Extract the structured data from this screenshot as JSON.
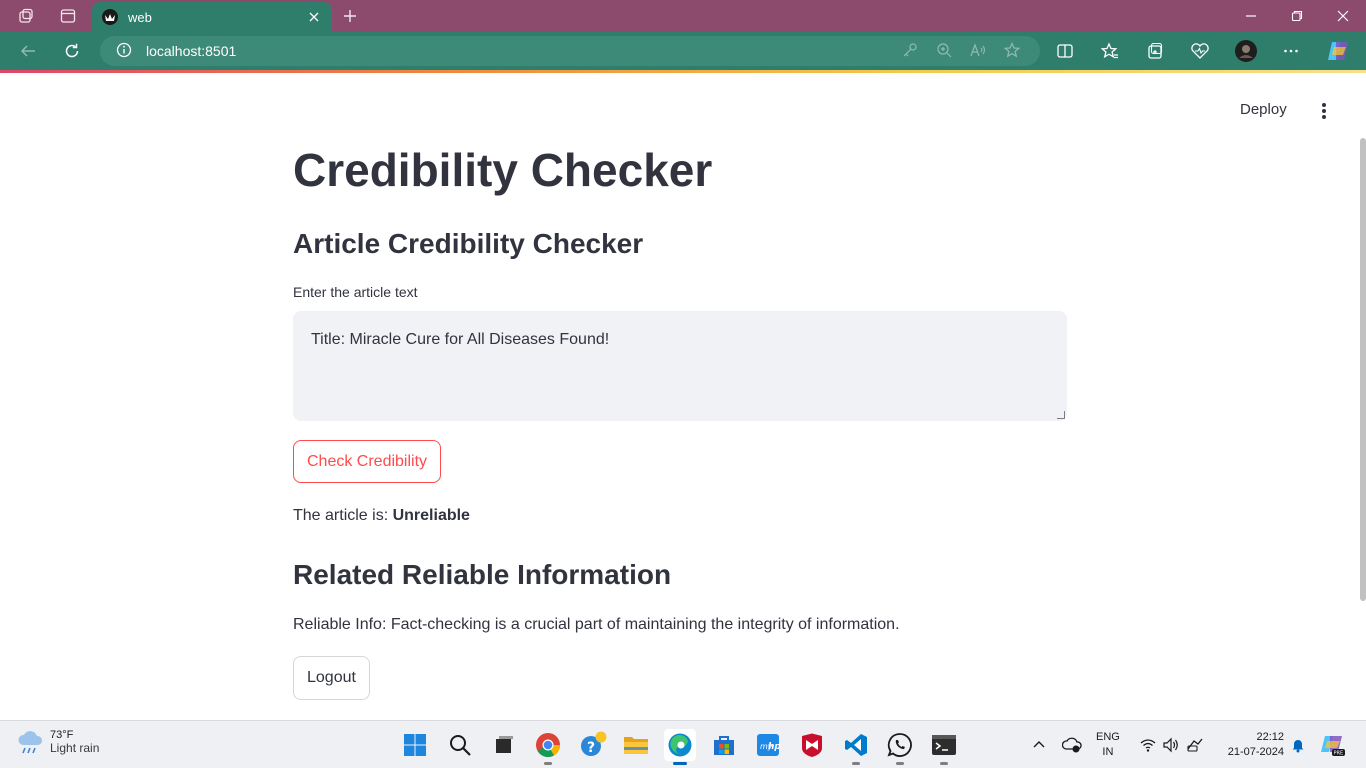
{
  "browser": {
    "tab_title": "web",
    "url": "localhost:8501"
  },
  "app_header": {
    "deploy_label": "Deploy"
  },
  "main": {
    "title": "Credibility Checker",
    "section_title": "Article Credibility Checker",
    "input_label": "Enter the article text",
    "input_value": "Title: Miracle Cure for All Diseases Found!",
    "check_button": "Check Credibility",
    "result_prefix": "The article is:",
    "result_value": "Unreliable",
    "related_title": "Related Reliable Information",
    "related_text": "Reliable Info: Fact-checking is a crucial part of maintaining the integrity of information.",
    "logout_button": "Logout"
  },
  "taskbar": {
    "weather_temp": "73°F",
    "weather_condition": "Light rain",
    "lang_top": "ENG",
    "lang_bottom": "IN",
    "time": "22:12",
    "date": "21-07-2024",
    "apps": [
      "start-icon",
      "search-icon",
      "task-view-icon",
      "chrome-icon",
      "help-icon",
      "file-explorer-icon",
      "edge-icon",
      "store-icon",
      "hp-icon",
      "mcafee-icon",
      "vscode-icon",
      "whatsapp-icon",
      "terminal-icon"
    ]
  },
  "colors": {
    "tabstrip": "#8c4a6c",
    "toolbar": "#2f7d6b",
    "accent": "#ff4b4b",
    "text": "#31333f",
    "textarea_bg": "#f0f2f6"
  }
}
